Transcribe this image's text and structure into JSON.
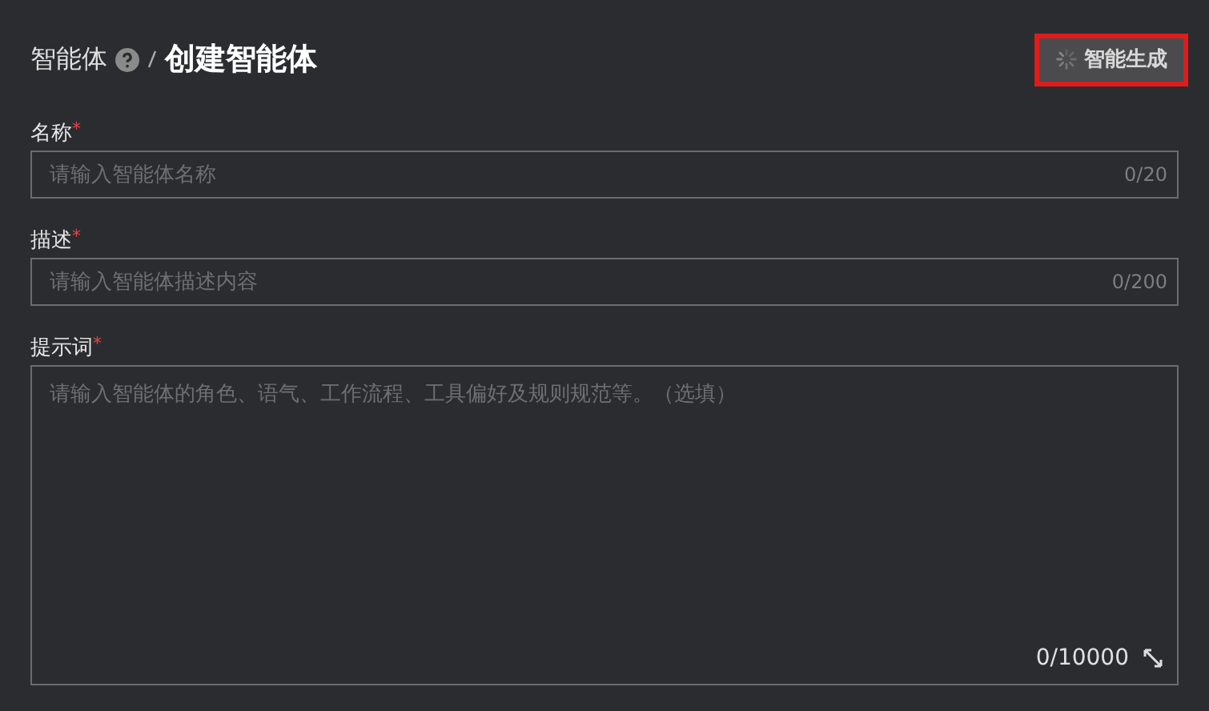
{
  "breadcrumb": {
    "parent": "智能体",
    "current": "创建智能体"
  },
  "generate_button": {
    "label": "智能生成",
    "loading": true,
    "highlighted": true
  },
  "fields": [
    {
      "kind": "input",
      "label": "名称",
      "required_mark": "*",
      "placeholder": "请输入智能体名称",
      "counter": "0/20"
    },
    {
      "kind": "input",
      "label": "描述",
      "required_mark": "*",
      "placeholder": "请输入智能体描述内容",
      "counter": "0/200"
    },
    {
      "kind": "textarea",
      "label": "提示词",
      "required_mark": "*",
      "placeholder": "请输入智能体的角色、语气、工作流程、工具偏好及规则规范等。（选填）",
      "counter": "0/10000"
    }
  ]
}
